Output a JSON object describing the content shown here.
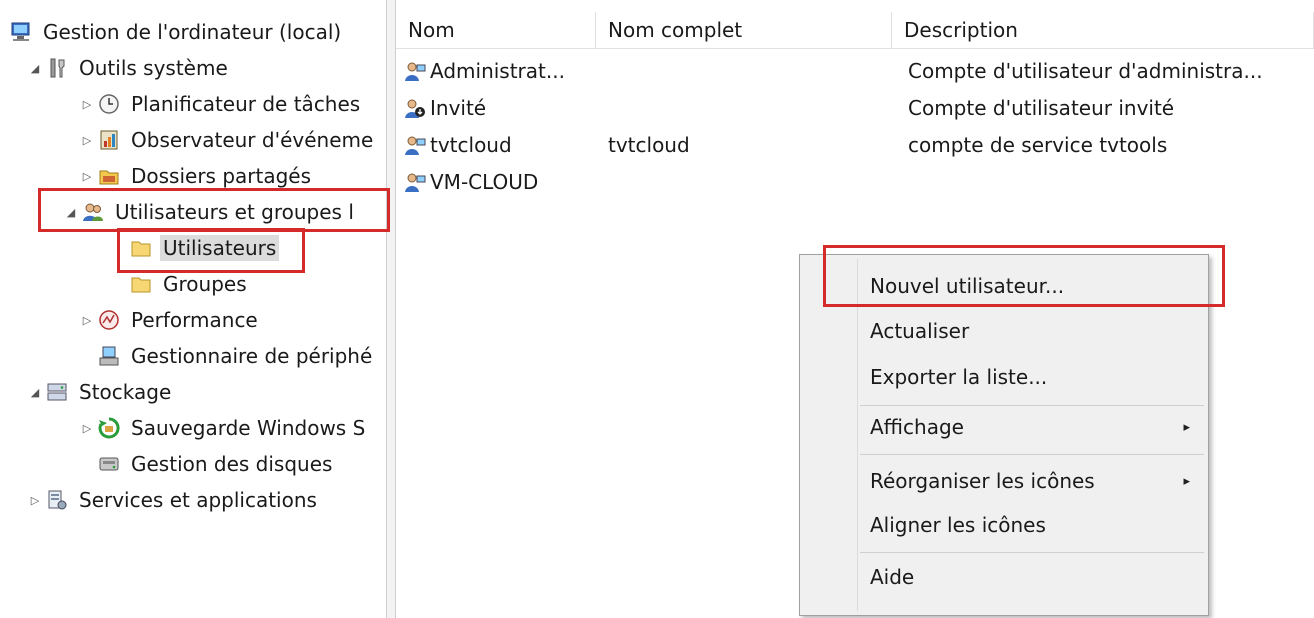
{
  "tree": {
    "root": "Gestion de l'ordinateur (local)",
    "system_tools": "Outils système",
    "task_scheduler": "Planificateur de tâches",
    "event_viewer": "Observateur d'événeme",
    "shared_folders": "Dossiers partagés",
    "local_users_groups": "Utilisateurs et groupes l",
    "users": "Utilisateurs",
    "groups": "Groupes",
    "performance": "Performance",
    "device_manager": "Gestionnaire de périphé",
    "storage": "Stockage",
    "windows_backup": "Sauvegarde Windows S",
    "disk_management": "Gestion des disques",
    "services_apps": "Services et applications"
  },
  "list": {
    "columns": [
      "Nom",
      "Nom complet",
      "Description"
    ],
    "rows": [
      {
        "name": "Administrat...",
        "full_name": "",
        "description": "Compte d'utilisateur d'administra...",
        "icon": "user-icon"
      },
      {
        "name": "Invité",
        "full_name": "",
        "description": "Compte d'utilisateur invité",
        "icon": "disabled-user-icon"
      },
      {
        "name": "tvtcloud",
        "full_name": "tvtcloud",
        "description": "compte de service tvtools",
        "icon": "user-icon"
      },
      {
        "name": "VM-CLOUD",
        "full_name": "",
        "description": "",
        "icon": "user-icon"
      }
    ]
  },
  "context_menu": {
    "new_user": "Nouvel utilisateur...",
    "refresh": "Actualiser",
    "export_list": "Exporter la liste...",
    "view": "Affichage",
    "arrange_icons": "Réorganiser les icônes",
    "line_up_icons": "Aligner les icônes",
    "help": "Aide",
    "submenu_arrow": "▸"
  },
  "colors": {
    "highlight_box": "#d42a2a",
    "menu_background": "#f0f0f0",
    "selection": "#dcdcdc"
  }
}
